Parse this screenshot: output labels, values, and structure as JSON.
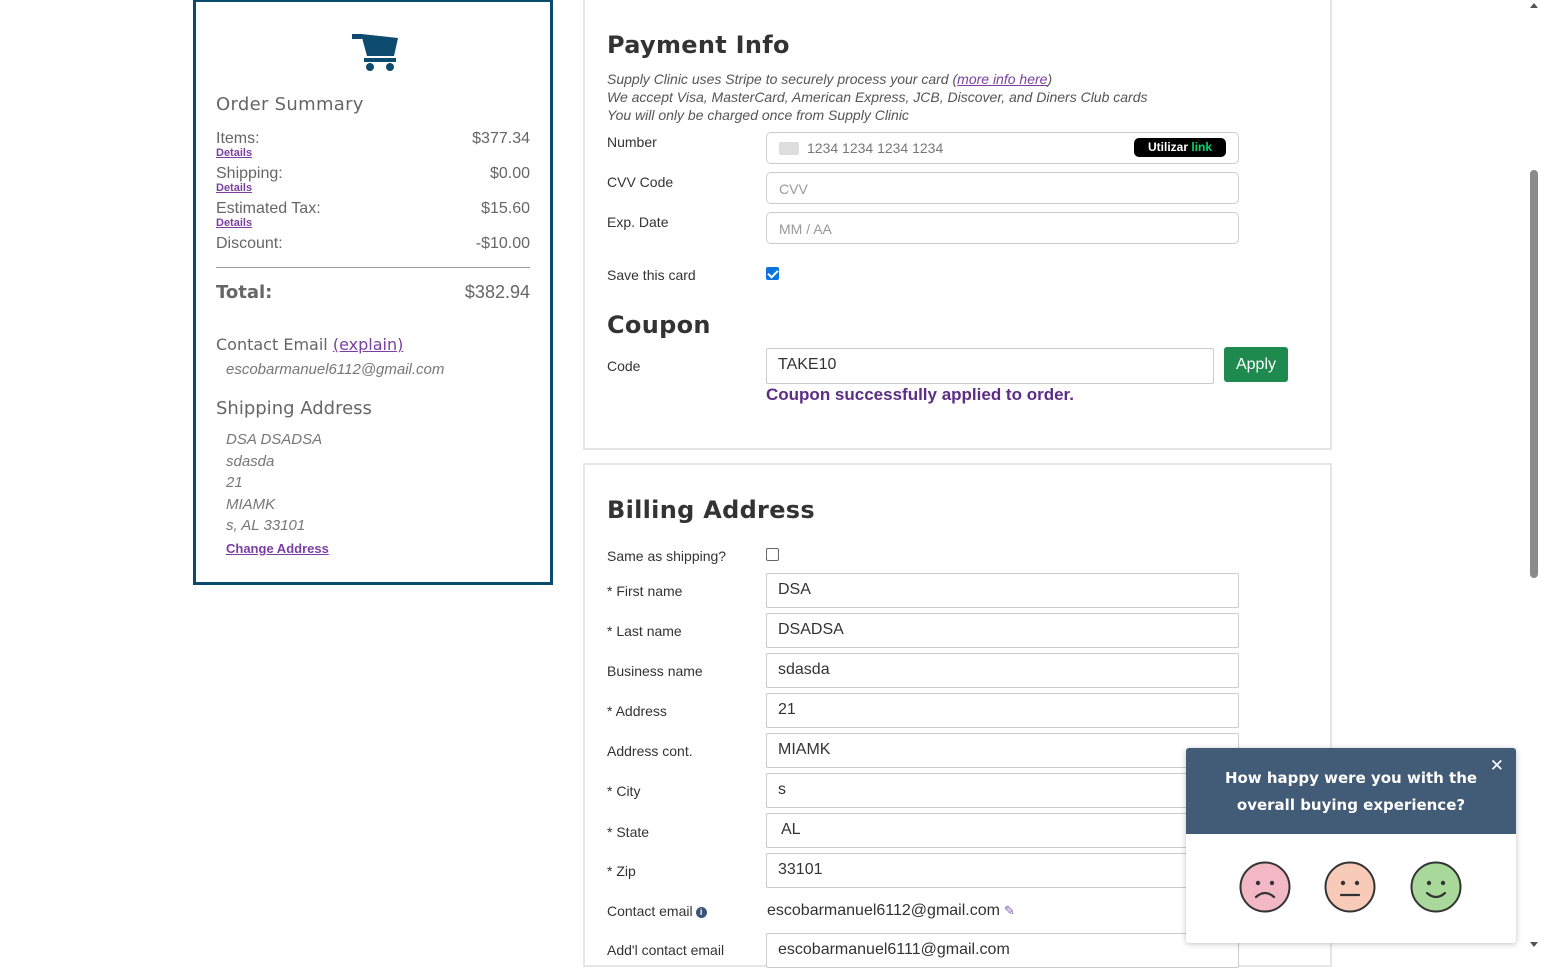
{
  "summary": {
    "title": "Order Summary",
    "items_label": "Items:",
    "items_value": "$377.34",
    "shipping_label": "Shipping:",
    "shipping_value": "$0.00",
    "tax_label": "Estimated Tax:",
    "tax_value": "$15.60",
    "discount_label": "Discount:",
    "discount_value": "-$10.00",
    "details_link": "Details",
    "total_label": "Total:",
    "total_value": "$382.94",
    "contact_title": "Contact Email",
    "contact_explain": "(explain)",
    "contact_email": "escobarmanuel6112@gmail.com",
    "shipping_title": "Shipping Address",
    "address_lines": [
      "DSA DSADSA",
      "sdasda",
      "21",
      "MIAMK",
      "s, AL 33101"
    ],
    "change_address": "Change Address"
  },
  "payment": {
    "title": "Payment Info",
    "note_line1_pre": "Supply Clinic uses Stripe to securely process your card (",
    "note_link": "more info here",
    "note_line1_post": ")",
    "note_line2": "We accept Visa, MasterCard, American Express, JCB, Discover, and Diners Club cards",
    "note_line3": "You will only be charged once from Supply Clinic",
    "number_label": "Number",
    "number_placeholder": "1234 1234 1234 1234",
    "link_badge_prefix": "Utilizar",
    "link_badge_brand": "link",
    "cvv_label": "CVV Code",
    "cvv_placeholder": "CVV",
    "exp_label": "Exp. Date",
    "exp_placeholder": "MM / AA",
    "save_label": "Save this card",
    "save_checked": true
  },
  "coupon": {
    "title": "Coupon",
    "code_label": "Code",
    "code_value": "TAKE10",
    "apply_label": "Apply",
    "success_message": "Coupon successfully applied to order."
  },
  "billing": {
    "title": "Billing Address",
    "same_label": "Same as shipping?",
    "same_checked": false,
    "first_name_label": "* First name",
    "first_name": "DSA",
    "last_name_label": "* Last name",
    "last_name": "DSADSA",
    "business_label": "Business name",
    "business": "sdasda",
    "address_label": "* Address",
    "address": "21",
    "address2_label": "Address cont.",
    "address2": "MIAMK",
    "city_label": "* City",
    "city": "s",
    "state_label": "* State",
    "state": "AL",
    "zip_label": "* Zip",
    "zip": "33101",
    "contact_label": "Contact email",
    "contact_value": "escobarmanuel6112@gmail.com",
    "addl_label": "Add'l contact email",
    "addl_value": "escobarmanuel6111@gmail.com"
  },
  "survey": {
    "question": "How happy were you with the overall buying experience?",
    "close_icon": "close-icon",
    "faces": [
      "sad-face-icon",
      "neutral-face-icon",
      "happy-face-icon"
    ]
  },
  "colors": {
    "brand_navy": "#0c4a6e",
    "link_purple": "#7b3fa0",
    "apply_green": "#1e8a4e",
    "survey_header": "#425b76"
  }
}
